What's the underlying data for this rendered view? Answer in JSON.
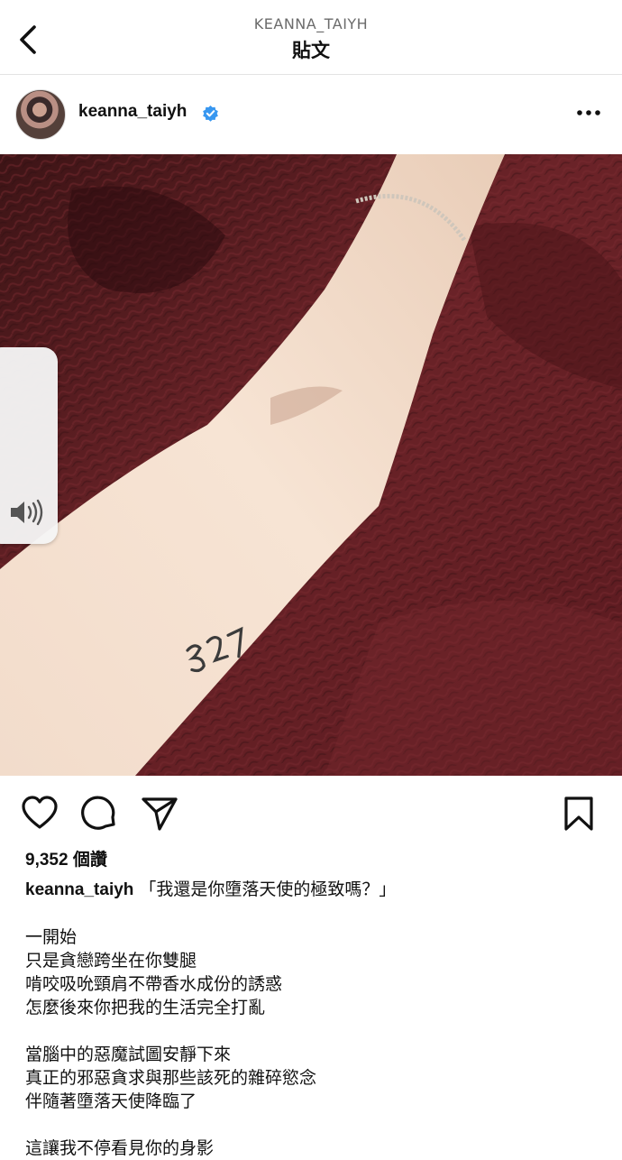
{
  "header": {
    "account": "KEANNA_TAIYH",
    "title": "貼文",
    "back_icon": "chevron-left-icon"
  },
  "post": {
    "username": "keanna_taiyh",
    "verified": true,
    "verified_color": "#3897f0",
    "more_icon": "more-horizontal-icon",
    "image": {
      "description_tattoo_text": "327",
      "volume_icon": "speaker-icon"
    },
    "actions": {
      "like_icon": "heart-icon",
      "comment_icon": "comment-bubble-icon",
      "share_icon": "send-icon",
      "save_icon": "bookmark-icon"
    },
    "likes_count": "9,352",
    "likes_unit": "個讚",
    "caption": {
      "username": "keanna_taiyh",
      "first_line": "「我還是你墮落天使的極致嗎？」",
      "stanza1": [
        "一開始",
        "只是貪戀跨坐在你雙腿",
        "啃咬吸吮頸肩不帶香水成份的誘惑",
        "怎麼後來你把我的生活完全打亂"
      ],
      "stanza2": [
        "當腦中的惡魔試圖安靜下來",
        "真正的邪惡貪求與那些該死的雜碎慾念",
        "伴隨著墮落天使降臨了"
      ],
      "stanza3": [
        "這讓我不停看見你的身影"
      ]
    }
  }
}
